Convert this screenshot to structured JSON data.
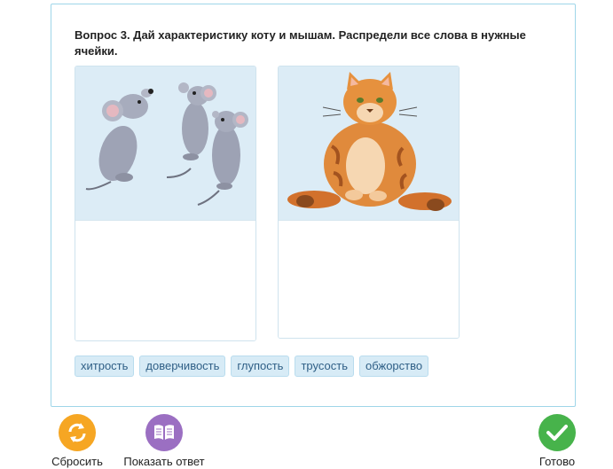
{
  "question": {
    "text": "Вопрос 3. Дай характеристику коту и мышам. Распредели все слова в нужные ячейки."
  },
  "columns": [
    {
      "picture": "mice-illustration"
    },
    {
      "picture": "cat-illustration"
    }
  ],
  "words": [
    "хитрость",
    "доверчивость",
    "глупость",
    "трусость",
    "обжорство"
  ],
  "controls": {
    "reset_label": "Сбросить",
    "show_answer_label": "Показать ответ",
    "done_label": "Готово"
  },
  "colors": {
    "accent_border": "#9fd6e9",
    "chip_bg": "#d7ebf6",
    "reset": "#f6a623",
    "show_answer": "#9b6fc2",
    "done": "#47b34b"
  }
}
